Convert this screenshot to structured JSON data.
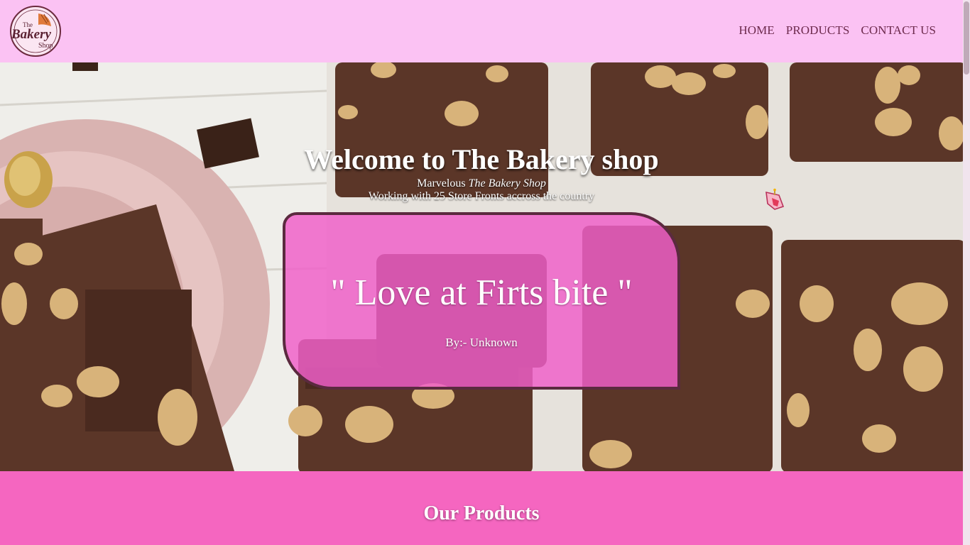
{
  "brand": {
    "logo_top": "The",
    "logo_main": "Bakery",
    "logo_bottom": "Shop"
  },
  "nav": {
    "home": "HOME",
    "products": "PRODUCTS",
    "contact": "CONTACT US"
  },
  "hero": {
    "title": "Welcome to The Bakery shop",
    "subtitle_prefix": "Marvelous ",
    "subtitle_brand": "The Bakery Shop",
    "subtitle_line2": "Working with 25 Store Fronts accross the country"
  },
  "quote": {
    "text": "\" Love at Firts bite \"",
    "author": "By:- Unknown"
  },
  "products": {
    "heading": "Our Products"
  },
  "colors": {
    "header_bg": "#fbc2f3",
    "nav_text": "#6d2a4d",
    "quote_box": "#f05fc8",
    "quote_border": "#5b2a3f",
    "section_bg": "#f566c0"
  },
  "icons": {
    "cursor": "cake-cursor-icon"
  }
}
